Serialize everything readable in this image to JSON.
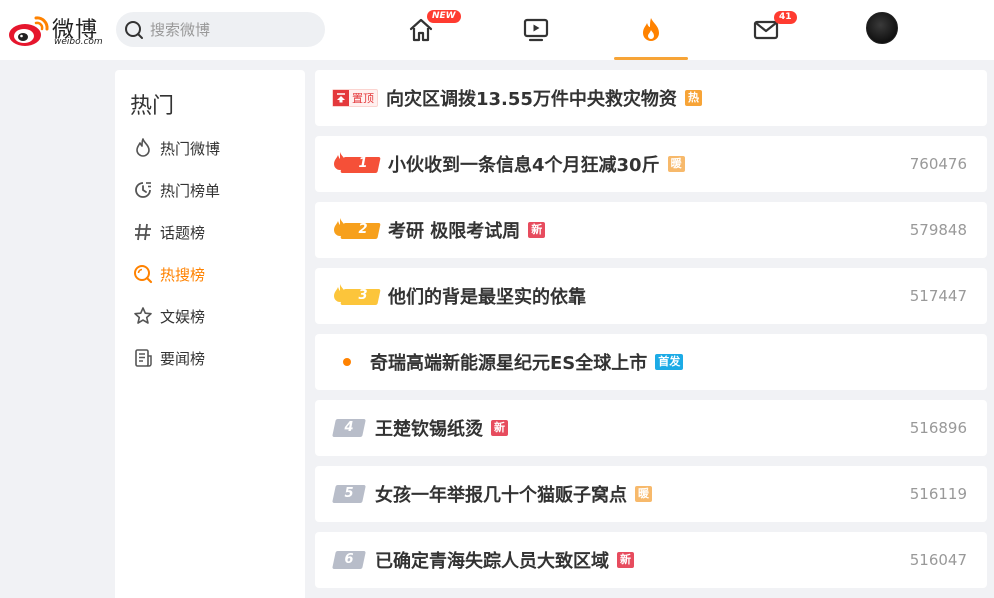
{
  "brand": {
    "name": "微博",
    "url": "weibo.com"
  },
  "search": {
    "placeholder": "搜索微博"
  },
  "nav": {
    "home_badge": "NEW",
    "messages_badge": "41"
  },
  "sidebar": {
    "title": "热门",
    "items": [
      {
        "label": "热门微博",
        "icon": "flame-outline-icon"
      },
      {
        "label": "热门榜单",
        "icon": "clock-list-icon"
      },
      {
        "label": "话题榜",
        "icon": "hashtag-icon"
      },
      {
        "label": "热搜榜",
        "icon": "search-circle-icon",
        "active": true
      },
      {
        "label": "文娱榜",
        "icon": "star-icon"
      },
      {
        "label": "要闻榜",
        "icon": "news-icon"
      }
    ]
  },
  "hot_list": {
    "pinned": {
      "badge": "置顶",
      "title": "向灾区调拨13.55万件中央救灾物资",
      "tag": "热"
    },
    "entries": [
      {
        "rank": "1",
        "title": "小伙收到一条信息4个月狂减30斤",
        "tag": "暖",
        "count": "760476"
      },
      {
        "rank": "2",
        "title": "考研 极限考试周",
        "tag": "新",
        "count": "579848"
      },
      {
        "rank": "3",
        "title": "他们的背是最坚实的依靠",
        "tag": "",
        "count": "517447"
      },
      {
        "rank": "",
        "title": "奇瑞高端新能源星纪元ES全球上市",
        "tag": "首发",
        "count": ""
      },
      {
        "rank": "4",
        "title": "王楚钦锡纸烫",
        "tag": "新",
        "count": "516896"
      },
      {
        "rank": "5",
        "title": "女孩一年举报几十个猫贩子窝点",
        "tag": "暖",
        "count": "516119"
      },
      {
        "rank": "6",
        "title": "已确定青海失踪人员大致区域",
        "tag": "新",
        "count": "516047"
      }
    ]
  },
  "colors": {
    "accent": "#ff8200",
    "rank1": "#f55038",
    "rank2": "#f7a01c",
    "rank3": "#fcc53b",
    "rank_plain": "#b8bdc9"
  }
}
